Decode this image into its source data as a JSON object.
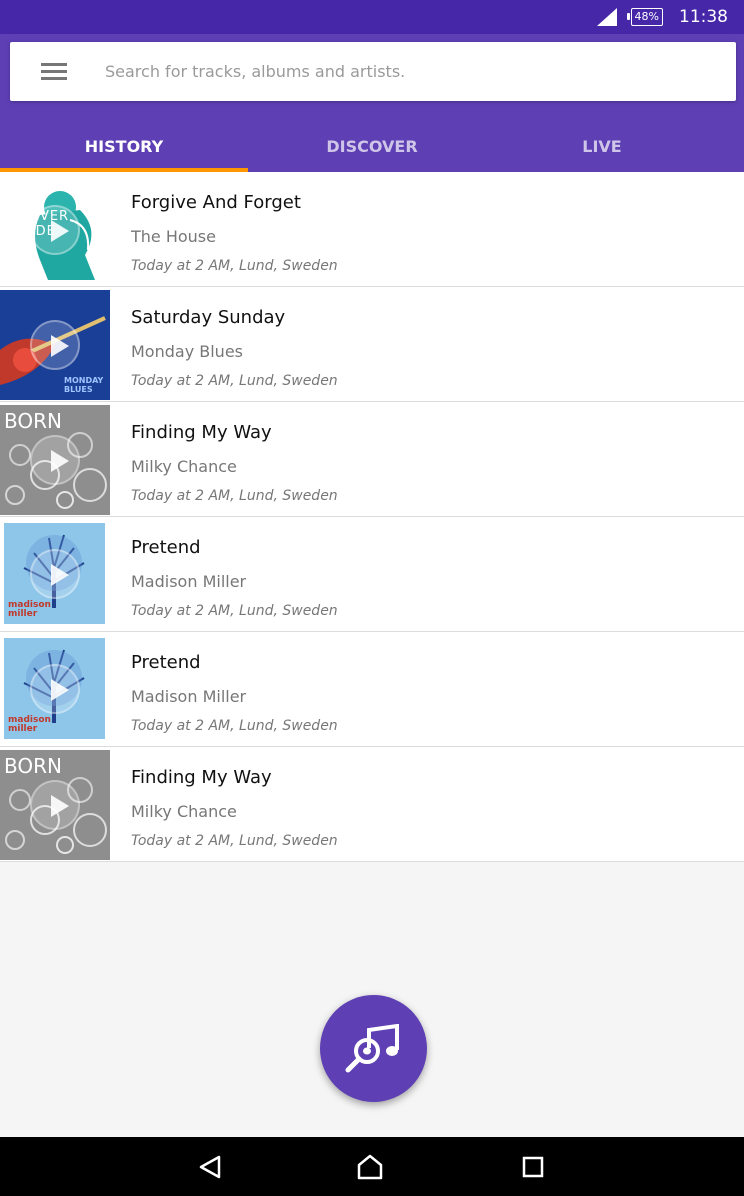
{
  "status_bar": {
    "battery": "48%",
    "time": "11:38"
  },
  "search": {
    "placeholder": "Search for tracks, albums and artists."
  },
  "tabs": [
    {
      "label": "HISTORY",
      "active": true
    },
    {
      "label": "DISCOVER",
      "active": false
    },
    {
      "label": "LIVE",
      "active": false
    }
  ],
  "history": [
    {
      "title": "Forgive And Forget",
      "artist": "The House",
      "meta": "Today at 2 AM, Lund, Sweden",
      "art": "NEVER HIDE"
    },
    {
      "title": "Saturday Sunday",
      "artist": "Monday Blues",
      "meta": "Today at 2 AM, Lund, Sweden",
      "art": "MONDAY BLUES"
    },
    {
      "title": "Finding My Way",
      "artist": "Milky Chance",
      "meta": "Today at 2 AM, Lund, Sweden",
      "art": "BORN"
    },
    {
      "title": "Pretend",
      "artist": "Madison Miller",
      "meta": "Today at 2 AM, Lund, Sweden",
      "art": "madison miller"
    },
    {
      "title": "Pretend",
      "artist": "Madison Miller",
      "meta": "Today at 2 AM, Lund, Sweden",
      "art": "madison miller"
    },
    {
      "title": "Finding My Way",
      "artist": "Milky Chance",
      "meta": "Today at 2 AM, Lund, Sweden",
      "art": "BORN"
    }
  ],
  "colors": {
    "primary": "#5e3fb4",
    "primary_dark": "#4527a8",
    "accent": "#ff9800"
  },
  "icons": {
    "menu": "menu-icon",
    "fab": "music-search-icon",
    "back": "back-icon",
    "home": "home-icon",
    "recents": "recents-icon"
  }
}
